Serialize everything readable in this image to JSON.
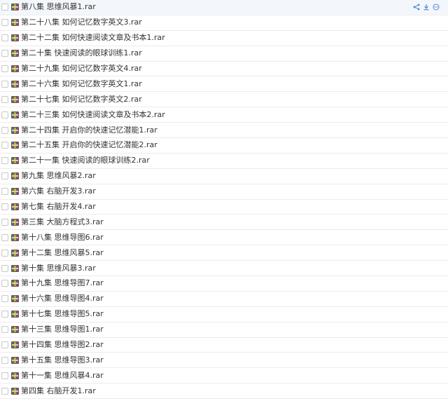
{
  "files": [
    {
      "name": "第八集 思维风暴1.rar"
    },
    {
      "name": "第二十八集 如何记忆数字英文3.rar"
    },
    {
      "name": "第二十二集 如何快速阅读文章及书本1.rar"
    },
    {
      "name": "第二十集 快速阅读的眼球训练1.rar"
    },
    {
      "name": "第二十九集 如何记忆数字英文4.rar"
    },
    {
      "name": "第二十六集 如何记忆数字英文1.rar"
    },
    {
      "name": "第二十七集 如何记忆数字英文2.rar"
    },
    {
      "name": "第二十三集 如何快速阅读文章及书本2.rar"
    },
    {
      "name": "第二十四集 开启你的快速记忆潜能1.rar"
    },
    {
      "name": "第二十五集 开启你的快速记忆潜能2.rar"
    },
    {
      "name": "第二十一集 快速阅读的眼球训练2.rar"
    },
    {
      "name": "第九集 思维风暴2.rar"
    },
    {
      "name": "第六集 右脑开发3.rar"
    },
    {
      "name": "第七集 右脑开发4.rar"
    },
    {
      "name": "第三集 大脑方程式3.rar"
    },
    {
      "name": "第十八集 思维导图6.rar"
    },
    {
      "name": "第十二集 思维风暴5.rar"
    },
    {
      "name": "第十集 思维风暴3.rar"
    },
    {
      "name": "第十九集 思维导图7.rar"
    },
    {
      "name": "第十六集 思维导图4.rar"
    },
    {
      "name": "第十七集 思维导图5.rar"
    },
    {
      "name": "第十三集 思维导图1.rar"
    },
    {
      "name": "第十四集 思维导图2.rar"
    },
    {
      "name": "第十五集 思维导图3.rar"
    },
    {
      "name": "第十一集 思维风暴4.rar"
    },
    {
      "name": "第四集 右脑开发1.rar"
    }
  ],
  "row_actions": {
    "icons": [
      "share-icon",
      "download-icon",
      "more-icon"
    ]
  },
  "colors": {
    "accent": "#5b8fd0",
    "hover_row": "#f3f7fc",
    "divider": "#ececec"
  }
}
